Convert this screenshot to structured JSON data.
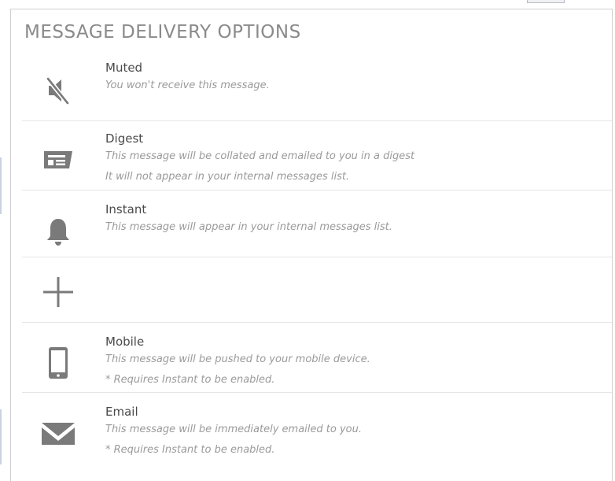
{
  "panel": {
    "title": "MESSAGE DELIVERY OPTIONS"
  },
  "options": [
    {
      "id": "muted",
      "icon": "muted-speaker-icon",
      "label": "Muted",
      "description": [
        "You won't receive this message."
      ]
    },
    {
      "id": "digest",
      "icon": "newspaper-icon",
      "label": "Digest",
      "description": [
        "This message will be collated and emailed to you in a digest",
        "It will not appear in your internal messages list."
      ]
    },
    {
      "id": "instant",
      "icon": "bell-icon",
      "label": "Instant",
      "description": [
        "This message will appear in your internal messages list."
      ]
    },
    {
      "id": "add",
      "icon": "plus-icon"
    },
    {
      "id": "mobile",
      "icon": "mobile-phone-icon",
      "label": "Mobile",
      "description": [
        "This message will be pushed to your mobile device.",
        "* Requires Instant to be enabled."
      ]
    },
    {
      "id": "email",
      "icon": "envelope-icon",
      "label": "Email",
      "description": [
        "This message will be immediately emailed to you.",
        "* Requires Instant to be enabled."
      ]
    }
  ],
  "colors": {
    "icon": "#7a7a7a",
    "title": "#8a8a8a",
    "label": "#4a4a4a",
    "description": "#9a9a9a",
    "divider": "#e6e6e6",
    "border": "#cfcfcf"
  }
}
